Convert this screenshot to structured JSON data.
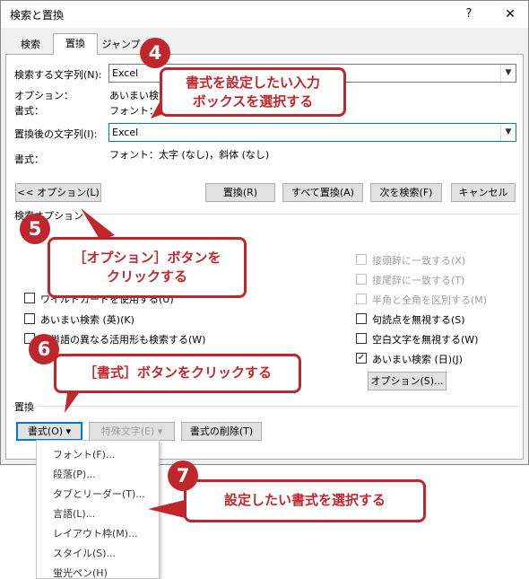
{
  "dialog": {
    "title": "検索と置換",
    "help": "?",
    "close": "✕",
    "tabs": [
      "検索",
      "置換",
      "ジャンプ"
    ],
    "find_label": "検索する文字列(N):",
    "find_value": "Excel",
    "options_label": "オプション：",
    "options_value": "あいまい検索",
    "find_format_label": "書式：",
    "find_format_value": "フォント：太",
    "replace_label": "置換後の文字列(I):",
    "replace_value": "Excel",
    "replace_format_label": "書式：",
    "replace_format_value": "フォント：太字 (なし)，斜体 (なし)",
    "options_toggle": "<< オプション(L)",
    "buttons": {
      "replace": "置換(R)",
      "replace_all": "すべて置換(A)",
      "find_next": "次を検索(F)",
      "cancel": "キャンセル"
    },
    "search_options_heading": "検索オプション",
    "left_checks": [
      {
        "label": "ワイルドカードを使用する(U)",
        "checked": false
      },
      {
        "label": "あいまい検索 (英)(K)",
        "checked": false
      },
      {
        "label": "英単語の異なる活用形も検索する(W)",
        "checked": false
      }
    ],
    "right_checks": [
      {
        "label": "接頭辞に一致する(X)",
        "checked": false,
        "disabled": true
      },
      {
        "label": "接尾辞に一致する(T)",
        "checked": false,
        "disabled": true
      },
      {
        "label": "半角と全角を区別する(M)",
        "checked": false,
        "disabled": true
      },
      {
        "label": "句読点を無視する(S)",
        "checked": false,
        "disabled": false
      },
      {
        "label": "空白文字を無視する(W)",
        "checked": false,
        "disabled": false
      },
      {
        "label": "あいまい検索 (日)(J)",
        "checked": true,
        "disabled": false
      }
    ],
    "fuzzy_options_button": "オプション(S)...",
    "replace_section_label": "置換",
    "format_button": "書式(O)",
    "special_button": "特殊文字(E)",
    "clear_format_button": "書式の削除(T)"
  },
  "format_menu": [
    "フォント(F)...",
    "段落(P)...",
    "タブとリーダー(T)...",
    "言語(L)...",
    "レイアウト枠(M)...",
    "スタイル(S)...",
    "蛍光ペン(H)"
  ],
  "annotations": {
    "step4": {
      "number": "4",
      "text1": "書式を設定したい入力",
      "text2": "ボックスを選択する"
    },
    "step5": {
      "number": "5",
      "text1": "［オプション］ボタンを",
      "text2": "クリックする"
    },
    "step6": {
      "number": "6",
      "text1": "［書式］ボタンをクリックする"
    },
    "step7": {
      "number": "7",
      "text1": "設定したい書式を選択する"
    }
  },
  "colors": {
    "accent_red": "#c0272d",
    "focus_blue": "#0078d7"
  }
}
